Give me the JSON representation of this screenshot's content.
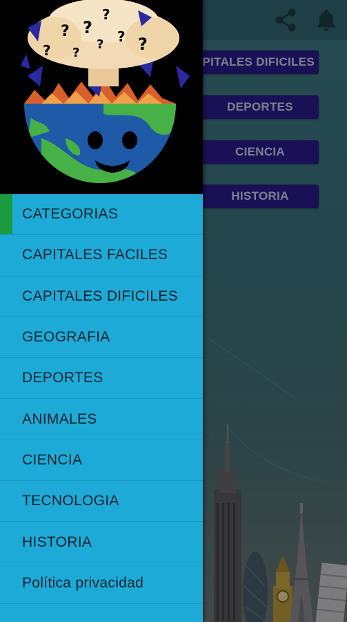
{
  "topbar": {
    "share_icon": "share-icon",
    "notification_icon": "bell-icon"
  },
  "categories_buttons": [
    {
      "label": "CAPITALES DIFICILES"
    },
    {
      "label": "DEPORTES"
    },
    {
      "label": "CIENCIA"
    },
    {
      "label": "HISTORIA"
    }
  ],
  "drawer": {
    "logo": "exploding-globe-question-marks-logo",
    "items": [
      {
        "label": "CATEGORIAS"
      },
      {
        "label": "CAPITALES FACILES"
      },
      {
        "label": "CAPITALES DIFICILES"
      },
      {
        "label": "GEOGRAFIA"
      },
      {
        "label": "DEPORTES"
      },
      {
        "label": "ANIMALES"
      },
      {
        "label": "CIENCIA"
      },
      {
        "label": "TECNOLOGIA"
      },
      {
        "label": "HISTORIA"
      },
      {
        "label": "Política privacidad"
      }
    ],
    "active_index": 0
  },
  "colors": {
    "drawer_bg": "#1eaad6",
    "active_indicator": "#1a9c3c",
    "button_bg": "#2b1b8c",
    "topbar_bg": "#2f6670"
  }
}
